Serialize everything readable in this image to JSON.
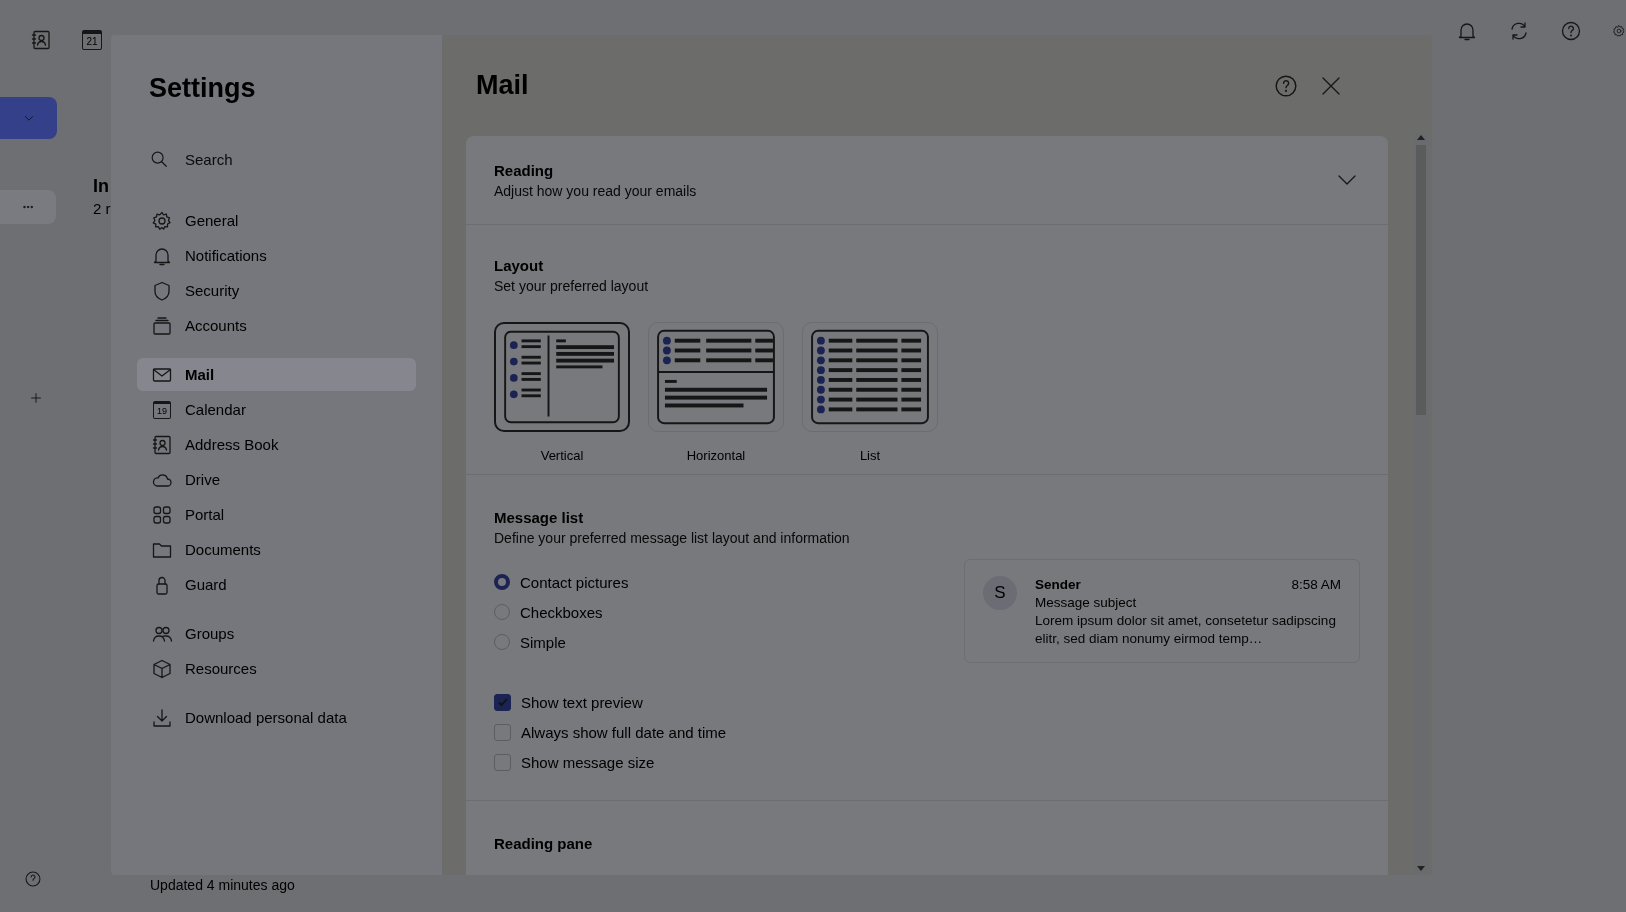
{
  "top_bar": {
    "calendar_day": "21"
  },
  "folder_pane": {
    "title": "In",
    "subtitle": "2 r"
  },
  "status": "Updated 4 minutes ago",
  "settings": {
    "title": "Settings",
    "search": {
      "placeholder": "Search"
    },
    "nav_groups": [
      [
        {
          "label": "General",
          "kind": "gear",
          "selected": false
        },
        {
          "label": "Notifications",
          "kind": "bell",
          "selected": false
        },
        {
          "label": "Security",
          "kind": "shield",
          "selected": false
        },
        {
          "label": "Accounts",
          "kind": "stack",
          "selected": false
        }
      ],
      [
        {
          "label": "Mail",
          "kind": "mail",
          "selected": true
        },
        {
          "label": "Calendar",
          "kind": "calendar",
          "icon_text": "19",
          "selected": false
        },
        {
          "label": "Address Book",
          "kind": "contact",
          "selected": false
        },
        {
          "label": "Drive",
          "kind": "cloud",
          "selected": false
        },
        {
          "label": "Portal",
          "kind": "grid",
          "selected": false
        },
        {
          "label": "Documents",
          "kind": "folder",
          "selected": false
        },
        {
          "label": "Guard",
          "kind": "lock",
          "selected": false
        }
      ],
      [
        {
          "label": "Groups",
          "kind": "people",
          "selected": false
        },
        {
          "label": "Resources",
          "kind": "cube",
          "selected": false
        }
      ],
      [
        {
          "label": "Download personal data",
          "kind": "download",
          "selected": false
        }
      ]
    ]
  },
  "page": {
    "title": "Mail",
    "reading": {
      "title": "Reading",
      "subtitle": "Adjust how you read your emails"
    },
    "layout": {
      "title": "Layout",
      "subtitle": "Set your preferred layout",
      "options": [
        {
          "label": "Vertical",
          "kind": "vertical",
          "selected": true
        },
        {
          "label": "Horizontal",
          "kind": "horizontal",
          "selected": false
        },
        {
          "label": "List",
          "kind": "list",
          "selected": false
        }
      ]
    },
    "message_list": {
      "title": "Message list",
      "subtitle": "Define your preferred message list layout and information",
      "radios": [
        {
          "label": "Contact pictures",
          "selected": true
        },
        {
          "label": "Checkboxes",
          "selected": false
        },
        {
          "label": "Simple",
          "selected": false
        }
      ],
      "checkboxes": [
        {
          "label": "Show text preview",
          "checked": true
        },
        {
          "label": "Always show full date and time",
          "checked": false
        },
        {
          "label": "Show message size",
          "checked": false
        }
      ],
      "preview": {
        "initial": "S",
        "sender": "Sender",
        "time": "8:58 AM",
        "subject": "Message subject",
        "text": "Lorem ipsum dolor sit amet, consetetur sadipscing elitr, sed diam nonumy eirmod temp…"
      }
    },
    "next_section": {
      "title": "Reading pane"
    }
  }
}
